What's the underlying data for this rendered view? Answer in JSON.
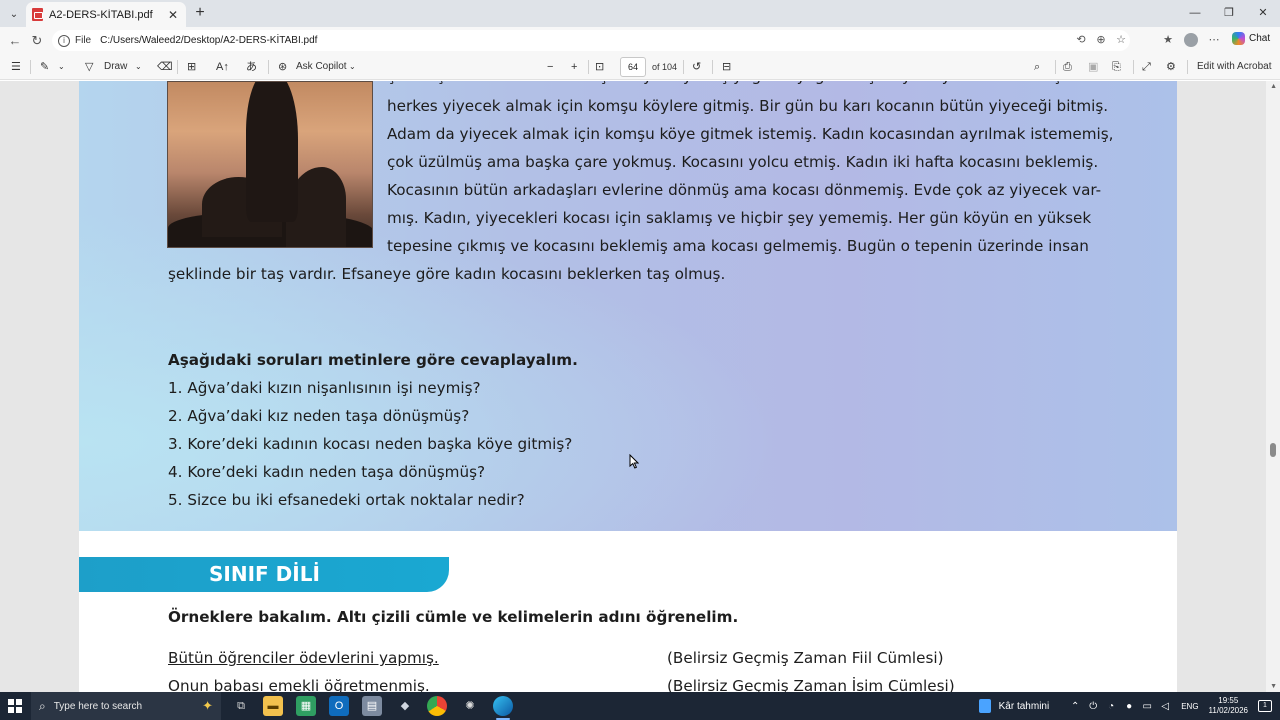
{
  "browser": {
    "tab": {
      "title": "A2-DERS-KİTABI.pdf"
    },
    "address": {
      "scheme": "File",
      "url": "C:/Users/Waleed2/Desktop/A2-DERS-KİTABI.pdf"
    },
    "chat_label": "Chat"
  },
  "pdf_toolbar": {
    "draw_label": "Draw",
    "copilot_label": "Ask Copilot",
    "page_current": "64",
    "page_total": "of 104",
    "acrobat_label": "Edit with Acrobat"
  },
  "document": {
    "story_lines_partial": [
      "çok küçük bir tarlaları varmış. Bir yıl köye hiç yağmur yağmamış. O yıl köyde kıtlık olmuş ve",
      "herkes yiyecek almak için komşu köylere gitmiş. Bir gün bu karı kocanın bütün yiyeceği bitmiş.",
      "Adam da yiyecek almak için komşu köye gitmek istemiş. Kadın kocasından ayrılmak istememiş,",
      "çok üzülmüş ama başka çare yokmuş. Kocasını yolcu etmiş. Kadın iki hafta kocasını beklemiş.",
      "Kocasının bütün arkadaşları evlerine dönmüş ama kocası dönmemiş. Evde çok az yiyecek var-",
      "mış. Kadın, yiyecekleri kocası için saklamış ve hiçbir şey yememiş. Her gün köyün en yüksek",
      "tepesine çıkmış ve kocasını beklemiş ama kocası gelmemiş. Bugün o tepenin üzerinde insan"
    ],
    "story_last_line": "şeklinde bir taş vardır. Efsaneye göre kadın kocasını beklerken taş olmuş.",
    "questions_heading": "Aşağıdaki soruları metinlere göre cevaplayalım.",
    "questions": [
      "1. Ağva’daki kızın nişanlısının işi neymiş?",
      "2. Ağva’daki kız neden taşa dönüşmüş?",
      "3. Kore’deki kadının kocası neden başka köye gitmiş?",
      "4. Kore’deki kadın neden taşa dönüşmüş?",
      "5. Sizce bu iki efsanedeki ortak noktalar nedir?"
    ],
    "section_title": "SINIF DİLİ",
    "examples_heading": "Örneklere bakalım. Altı çizili cümle ve kelimelerin adını öğrenelim.",
    "examples": [
      {
        "sentence": "Bütün öğrenciler ödevlerini yapmış.",
        "type": "(Belirsiz Geçmiş Zaman Fiil Cümlesi)"
      },
      {
        "sentence": "Onun babası emekli öğretmenmiş.",
        "type": "(Belirsiz Geçmiş Zaman İsim Cümlesi)"
      }
    ]
  },
  "taskbar": {
    "search_placeholder": "Type here to search",
    "weather": "Kâr tahmini",
    "language": "ENG",
    "time": "19:55",
    "date": "11/02/2026"
  }
}
